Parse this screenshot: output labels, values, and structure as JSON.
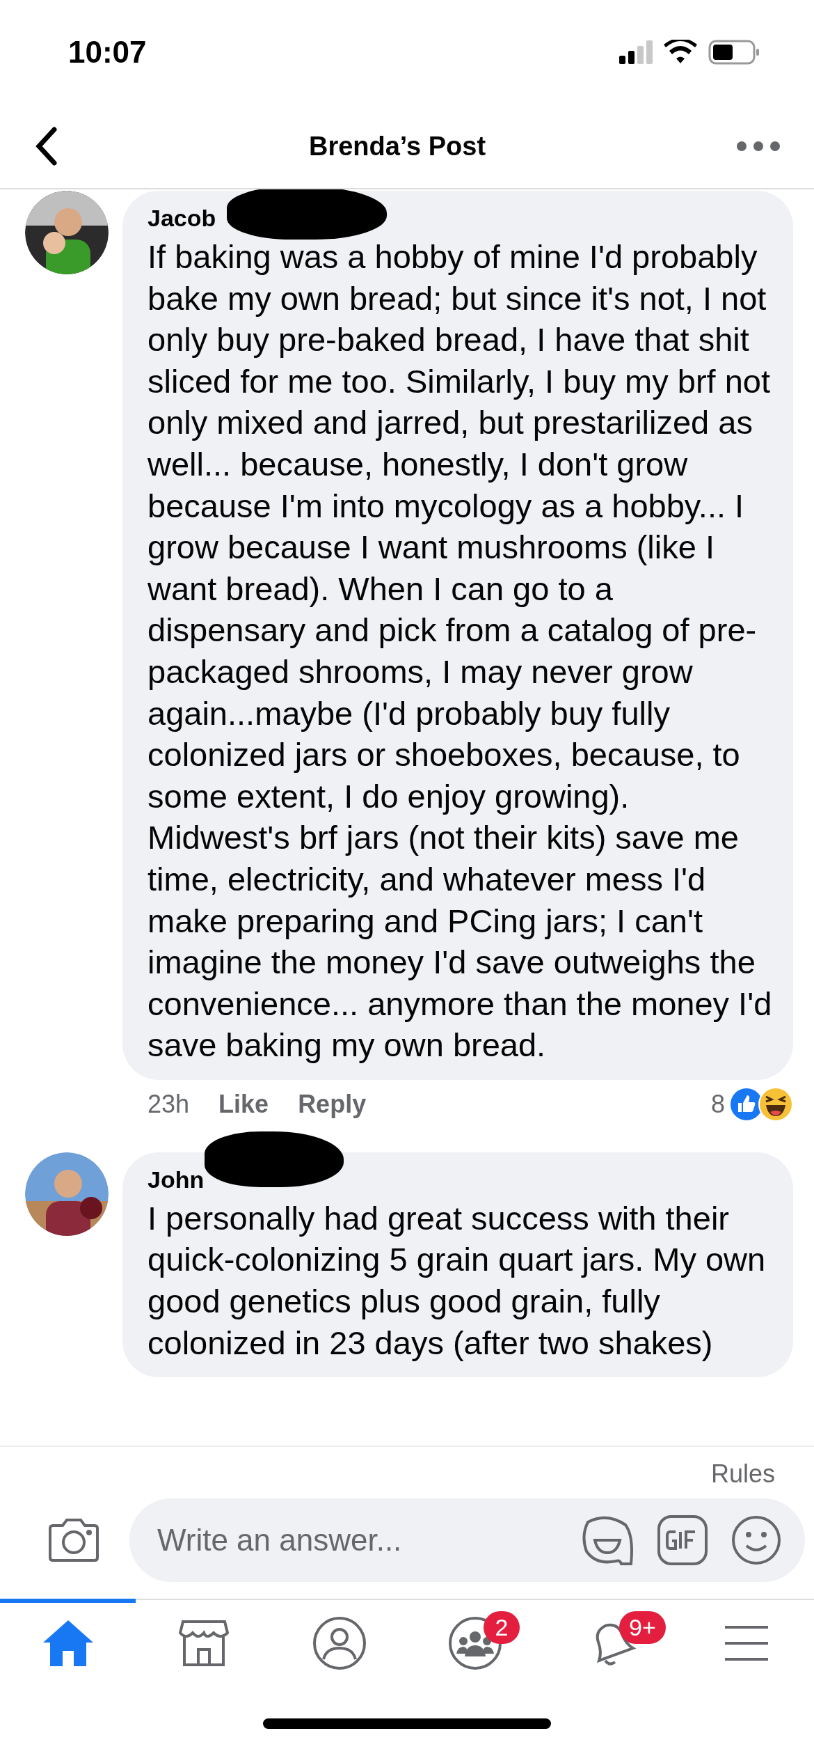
{
  "status_bar": {
    "time": "10:07"
  },
  "header": {
    "title": "Brenda’s Post"
  },
  "comments": [
    {
      "author": "Jacob",
      "redacted": true,
      "text": "If baking was a hobby of mine I'd probably bake my own bread; but since it's not, I not only buy pre-baked bread, I have that shit sliced for me too. Similarly, I buy my brf not only mixed and jarred, but prestarilized as well... because, honestly, I don't grow because I'm into mycology as a hobby... I grow because I want mushrooms (like I want bread). When I can go to a dispensary and pick from a catalog of pre-packaged shrooms, I may never grow again...maybe (I'd probably buy fully colonized jars or shoeboxes, because, to some extent, I do enjoy growing). Midwest's brf jars (not their kits) save me time, electricity, and whatever mess I'd make preparing and PCing jars; I can't imagine the money I'd save outweighs the convenience... anymore than the money I'd save baking my own bread.",
      "time": "23h",
      "actions": [
        "Like",
        "Reply"
      ],
      "reaction_count": "8"
    },
    {
      "author": "John",
      "redacted": true,
      "text": "I personally had great success with their quick-colonizing 5 grain quart jars. My own good genetics plus good grain, fully colonized in 23 days (after two shakes)"
    }
  ],
  "composer": {
    "rules_link": "Rules",
    "placeholder": "Write an answer..."
  },
  "tabs": [
    {
      "kind": "home",
      "selected": true
    },
    {
      "kind": "store",
      "selected": false
    },
    {
      "kind": "profile",
      "selected": false
    },
    {
      "kind": "groups",
      "selected": false,
      "badge": "2"
    },
    {
      "kind": "bell",
      "selected": false,
      "badge": "9+"
    },
    {
      "kind": "menu",
      "selected": false
    }
  ]
}
